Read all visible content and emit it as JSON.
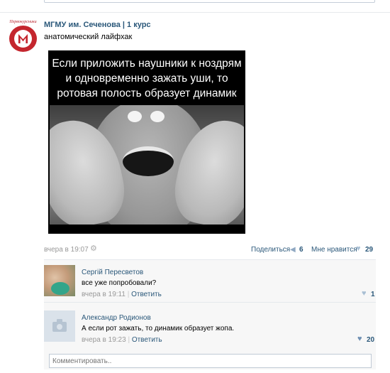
{
  "group": {
    "avatar_caption": "Первокурсники",
    "name": "МГМУ им. Сеченова | 1 курс"
  },
  "post": {
    "text": "анатомический лайфхак",
    "image_caption": "Если приложить наушники к ноздрям и одновременно зажать уши, то ротовая полость образует динамик",
    "date": "вчера в 19:07",
    "share_label": "Поделиться",
    "share_count": "6",
    "like_label": "Мне нравится",
    "like_count": "29"
  },
  "comments": [
    {
      "author": "Сергій Пересветов",
      "text": "все уже попробовали?",
      "date": "вчера в 19:11",
      "separator": "|",
      "reply_label": "Ответить",
      "likes": "1"
    },
    {
      "author": "Александр Родионов",
      "text": "А если рот зажать, то динамик образует жопа.",
      "date": "вчера в 19:23",
      "separator": "|",
      "reply_label": "Ответить",
      "likes": "20"
    }
  ],
  "comment_input": {
    "placeholder": "Комментировать.."
  },
  "icons": {
    "settings": "gear-icon",
    "share": "share-icon",
    "like": "heart-icon",
    "camera": "camera-icon"
  },
  "colors": {
    "link": "#2b587a",
    "muted": "#999999",
    "brand_red": "#c4262e",
    "comment_bg": "#f7f7f7"
  }
}
